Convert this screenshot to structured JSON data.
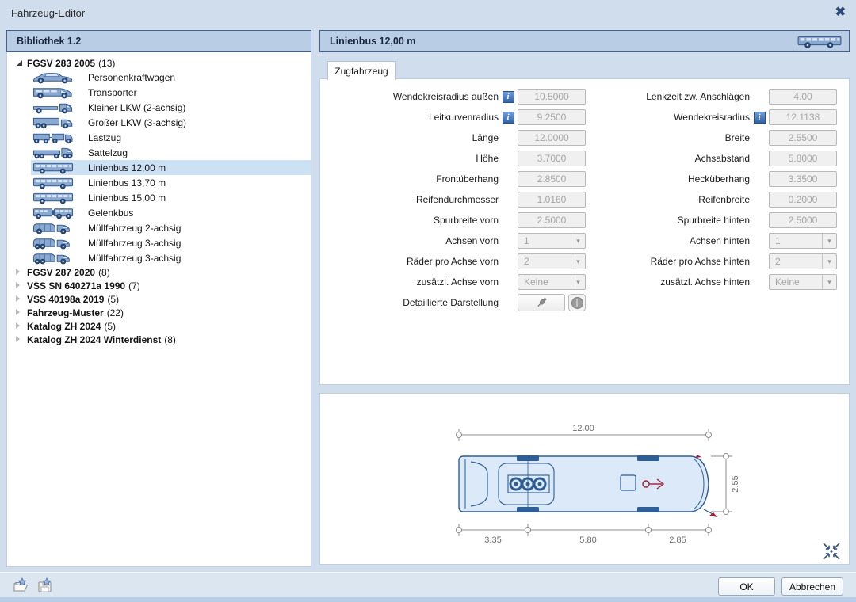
{
  "window": {
    "title": "Fahrzeug-Editor"
  },
  "icons": {
    "close": "✖",
    "dropdown_arrow": "▾",
    "info": "i"
  },
  "library": {
    "header": "Bibliothek 1.2",
    "tree": [
      {
        "type": "category",
        "expanded": true,
        "label": "FGSV 283 2005",
        "count": "(13)"
      },
      {
        "type": "vehicle",
        "icon": "car",
        "label": "Personenkraftwagen"
      },
      {
        "type": "vehicle",
        "icon": "van",
        "label": "Transporter"
      },
      {
        "type": "vehicle",
        "icon": "truck-small",
        "label": "Kleiner LKW (2-achsig)"
      },
      {
        "type": "vehicle",
        "icon": "truck-large",
        "label": "Großer LKW (3-achsig)"
      },
      {
        "type": "vehicle",
        "icon": "truck-trailer",
        "label": "Lastzug"
      },
      {
        "type": "vehicle",
        "icon": "semi-truck",
        "label": "Sattelzug"
      },
      {
        "type": "vehicle",
        "icon": "bus",
        "label": "Linienbus 12,00 m",
        "selected": true
      },
      {
        "type": "vehicle",
        "icon": "bus",
        "label": "Linienbus 13,70 m"
      },
      {
        "type": "vehicle",
        "icon": "bus",
        "label": "Linienbus 15,00 m"
      },
      {
        "type": "vehicle",
        "icon": "articulated-bus",
        "label": "Gelenkbus"
      },
      {
        "type": "vehicle",
        "icon": "garbage-truck",
        "label": "Müllfahrzeug 2-achsig"
      },
      {
        "type": "vehicle",
        "icon": "garbage-truck",
        "label": "Müllfahrzeug 3-achsig"
      },
      {
        "type": "vehicle",
        "icon": "garbage-truck",
        "label": "Müllfahrzeug 3-achsig"
      },
      {
        "type": "category",
        "expanded": false,
        "label": "FGSV 287 2020",
        "count": "(8)"
      },
      {
        "type": "category",
        "expanded": false,
        "label": "VSS SN 640271a 1990",
        "count": "(7)"
      },
      {
        "type": "category",
        "expanded": false,
        "label": "VSS 40198a 2019",
        "count": "(5)"
      },
      {
        "type": "category",
        "expanded": false,
        "label": "Fahrzeug-Muster",
        "count": "(22)"
      },
      {
        "type": "category",
        "expanded": false,
        "label": "Katalog ZH 2024",
        "count": "(5)"
      },
      {
        "type": "category",
        "expanded": false,
        "label": "Katalog ZH 2024 Winterdienst",
        "count": "(8)"
      }
    ]
  },
  "editor": {
    "header": "Linienbus 12,00 m",
    "tab": "Zugfahrzeug",
    "left": [
      {
        "label": "Wendekreisradius außen",
        "info": true,
        "value": "10.5000"
      },
      {
        "label": "Leitkurvenradius",
        "info": true,
        "value": "9.2500"
      },
      {
        "label": "Länge",
        "value": "12.0000"
      },
      {
        "label": "Höhe",
        "value": "3.7000"
      },
      {
        "label": "Frontüberhang",
        "value": "2.8500"
      },
      {
        "label": "Reifendurchmesser",
        "value": "1.0160"
      },
      {
        "label": "Spurbreite vorn",
        "value": "2.5000"
      },
      {
        "label": "Achsen vorn",
        "value": "1",
        "kind": "dropdown"
      },
      {
        "label": "Räder pro Achse vorn",
        "value": "2",
        "kind": "dropdown"
      },
      {
        "label": "zusätzl. Achse vorn",
        "value": "Keine",
        "kind": "dropdown"
      },
      {
        "label": "Detaillierte Darstellung",
        "kind": "buttons"
      }
    ],
    "right": [
      {
        "label": "Lenkzeit zw. Anschlägen",
        "value": "4.00"
      },
      {
        "label": "Wendekreisradius",
        "info": true,
        "value": "12.1138"
      },
      {
        "label": "Breite",
        "value": "2.5500"
      },
      {
        "label": "Achsabstand",
        "value": "5.8000"
      },
      {
        "label": "Hecküberhang",
        "value": "3.3500"
      },
      {
        "label": "Reifenbreite",
        "value": "0.2000"
      },
      {
        "label": "Spurbreite hinten",
        "value": "2.5000"
      },
      {
        "label": "Achsen hinten",
        "value": "1",
        "kind": "dropdown"
      },
      {
        "label": "Räder pro Achse hinten",
        "value": "2",
        "kind": "dropdown"
      },
      {
        "label": "zusätzl. Achse hinten",
        "value": "Keine",
        "kind": "dropdown"
      }
    ]
  },
  "diagram": {
    "total_length": "12.00",
    "vehicle_width": "2.55",
    "rear_overhang": "3.35",
    "wheelbase": "5.80",
    "front_overhang": "2.85"
  },
  "footer": {
    "ok": "OK",
    "cancel": "Abbrechen"
  },
  "colors": {
    "dialog_bg": "#cfdded",
    "header_bg": "#b9cee5",
    "header_border": "#43618c",
    "selection": "#cde1f5",
    "disabled_field_bg": "#f0f0f0",
    "disabled_text": "#a5a5a5",
    "bus_fill": "#dce9f8",
    "bus_outline": "#2d5e96",
    "accent_red": "#9e1f33"
  }
}
